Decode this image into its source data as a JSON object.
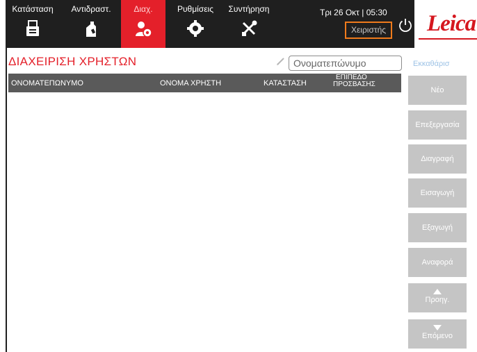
{
  "nav": {
    "tabs": [
      {
        "label": "Κατάσταση",
        "icon": "status-printer-icon"
      },
      {
        "label": "Αντιδραστ.",
        "icon": "reagents-bottle-icon"
      },
      {
        "label": "Διαχ.",
        "icon": "admin-users-gear-icon"
      },
      {
        "label": "Ρυθμίσεις",
        "icon": "settings-gear-icon"
      },
      {
        "label": "Συντήρηση",
        "icon": "maintenance-tools-icon"
      }
    ],
    "active_tab": "Διαχ."
  },
  "header": {
    "datetime": "Τρι 26 Οκτ | 05:30",
    "user_role": "Χειριστής",
    "logo": "Leica"
  },
  "page": {
    "title": "ΔΙΑΧΕΙΡΙΣΗ ΧΡΗΣΤΩΝ",
    "search_placeholder": "Ονοματεπώνυμο",
    "clear_label": "Εκκαθάρισ"
  },
  "table": {
    "columns": [
      "ΟΝΟΜΑΤΕΠΩΝΥΜΟ",
      "ΟΝΟΜΑ ΧΡΗΣΤΗ",
      "ΚΑΤΑΣΤΑΣΗ",
      "ΕΠΙΠΕΔΟ",
      "ΠΡΟΣΒΑΣΗΣ"
    ],
    "rows": []
  },
  "actions": {
    "new": "Νέο",
    "edit": "Επεξεργασία",
    "delete": "Διαγραφή",
    "import": "Εισαγωγή",
    "export": "Εξαγωγή",
    "report": "Αναφορά",
    "prev": "Προηγ.",
    "next": "Επόμενο"
  },
  "colors": {
    "accent_red": "#e4202a",
    "topbar": "#1f1f1f",
    "highlight_orange": "#f07b1c",
    "button_gray": "#c5c5c5",
    "table_header": "#5a5a5a"
  }
}
